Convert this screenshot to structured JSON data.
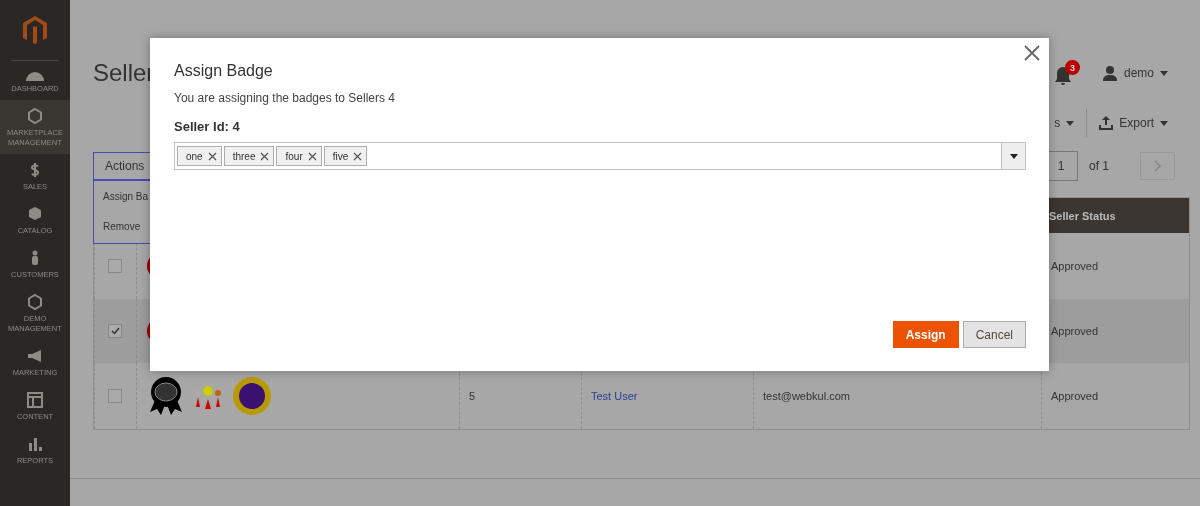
{
  "sidebar": {
    "items": [
      {
        "label": "DASHBOARD",
        "selected": false
      },
      {
        "label": "MARKETPLACE MANAGEMENT",
        "selected": true
      },
      {
        "label": "SALES",
        "selected": false
      },
      {
        "label": "CATALOG",
        "selected": false
      },
      {
        "label": "CUSTOMERS",
        "selected": false
      },
      {
        "label": "DEMO MANAGEMENT",
        "selected": false
      },
      {
        "label": "MARKETING",
        "selected": false
      },
      {
        "label": "CONTENT",
        "selected": false
      },
      {
        "label": "REPORTS",
        "selected": false
      }
    ]
  },
  "page": {
    "title": "Seller",
    "notifications": "3",
    "user": "demo",
    "toolbar": {
      "columns_fragment": "s",
      "export": "Export"
    },
    "actions": {
      "label": "Actions",
      "menu": [
        "Assign Ba",
        "Remove"
      ]
    },
    "pager": {
      "page": "1",
      "of": "of 1"
    }
  },
  "table": {
    "columns": [
      {
        "label": "Seller Status"
      }
    ],
    "rows": [
      {
        "checked": false,
        "kind": "seal",
        "status": "Approved"
      },
      {
        "checked": true,
        "kind": "seal",
        "status": "Approved"
      },
      {
        "checked": false,
        "kind": "set",
        "id": "5",
        "name": "Test User",
        "email": "test@webkul.com",
        "status": "Approved"
      }
    ]
  },
  "modal": {
    "title": "Assign Badge",
    "message": "You are assigning the badges to Sellers 4",
    "field_label": "Seller Id: 4",
    "tags": [
      "one",
      "three",
      "four",
      "five"
    ],
    "buttons": [
      {
        "label": "Assign",
        "kind": "primary"
      },
      {
        "label": "Cancel",
        "kind": "secondary"
      }
    ]
  }
}
